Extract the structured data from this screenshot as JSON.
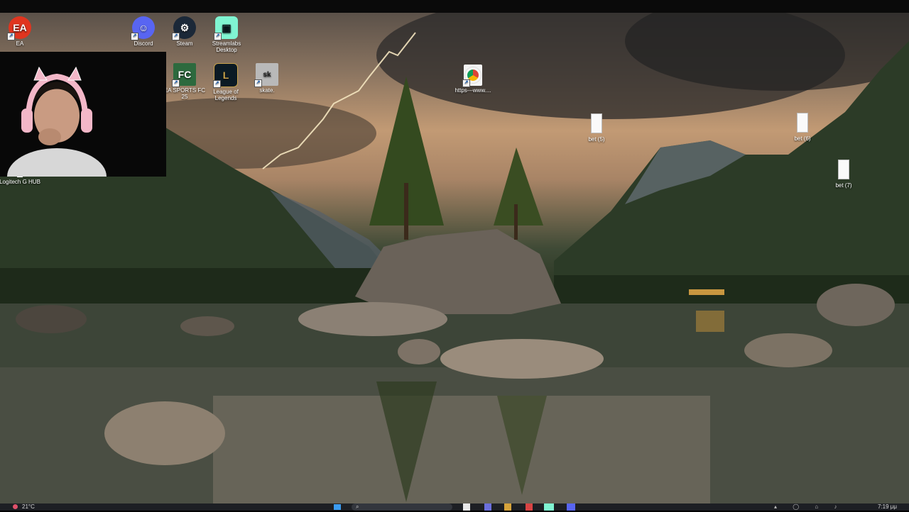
{
  "desktop": {
    "icons": [
      {
        "label": "EA",
        "icon": "ea-app-icon",
        "color": "#e0351f"
      },
      {
        "label": "Discord",
        "icon": "discord-icon",
        "color": "#5865f2"
      },
      {
        "label": "Steam",
        "icon": "steam-icon",
        "color": "#1b2838"
      },
      {
        "label": "Streamlabs Desktop",
        "icon": "streamlabs-icon",
        "color": "#80f5d2"
      },
      {
        "label": "EA SPORTS FC 25",
        "icon": "ea-sports-fc-icon",
        "color": "#2d6a3e"
      },
      {
        "label": "League of Legends",
        "icon": "league-of-legends-icon",
        "color": "#c8a24a"
      },
      {
        "label": "skate.",
        "icon": "skate-icon",
        "color": "#d9d9d9"
      },
      {
        "label": "https---www....",
        "icon": "chrome-shortcut-icon",
        "color": "#4285f4"
      },
      {
        "label": "bet (5)",
        "icon": "text-file-icon",
        "color": "#ffffff"
      },
      {
        "label": "bet (6)",
        "icon": "text-file-icon",
        "color": "#ffffff"
      },
      {
        "label": "bet (7)",
        "icon": "text-file-icon",
        "color": "#ffffff"
      },
      {
        "label": "Logitech G HUB",
        "icon": "logitech-g-hub-icon",
        "color": "#ffffff"
      }
    ]
  },
  "taskbar": {
    "weather": "21°C",
    "clock": "7:19 μμ"
  }
}
